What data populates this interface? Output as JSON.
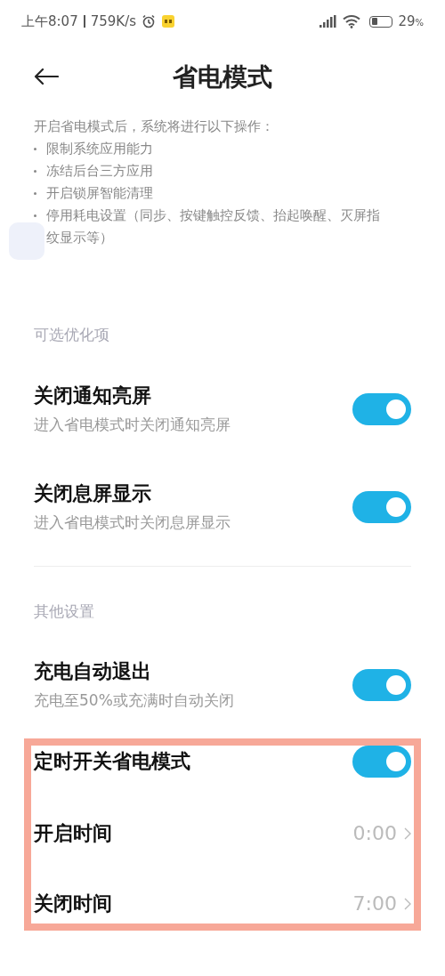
{
  "status_bar": {
    "time": "上午8:07",
    "speed": "759K/s",
    "battery": "29",
    "battery_unit": "%"
  },
  "header": {
    "title": "省电模式"
  },
  "description": {
    "intro": "开启省电模式后，系统将进行以下操作：",
    "bullets": [
      "限制系统应用能力",
      "冻结后台三方应用",
      "开启锁屏智能清理",
      "停用耗电设置（同步、按键触控反馈、抬起唤醒、灭屏指纹显示等）"
    ]
  },
  "sections": [
    {
      "header": "可选优化项",
      "items": [
        {
          "kind": "toggle",
          "title": "关闭通知亮屏",
          "subtitle": "进入省电模式时关闭通知亮屏",
          "on": true
        },
        {
          "kind": "toggle",
          "title": "关闭息屏显示",
          "subtitle": "进入省电模式时关闭息屏显示",
          "on": true
        }
      ]
    },
    {
      "header": "其他设置",
      "items": [
        {
          "kind": "toggle",
          "title": "充电自动退出",
          "subtitle": "充电至50%或充满时自动关闭",
          "on": true
        }
      ],
      "highlighted_items": [
        {
          "kind": "toggle",
          "title": "定时开关省电模式",
          "on": true
        },
        {
          "kind": "value",
          "title": "开启时间",
          "value": "0:00"
        },
        {
          "kind": "value",
          "title": "关闭时间",
          "value": "7:00"
        }
      ]
    }
  ]
}
